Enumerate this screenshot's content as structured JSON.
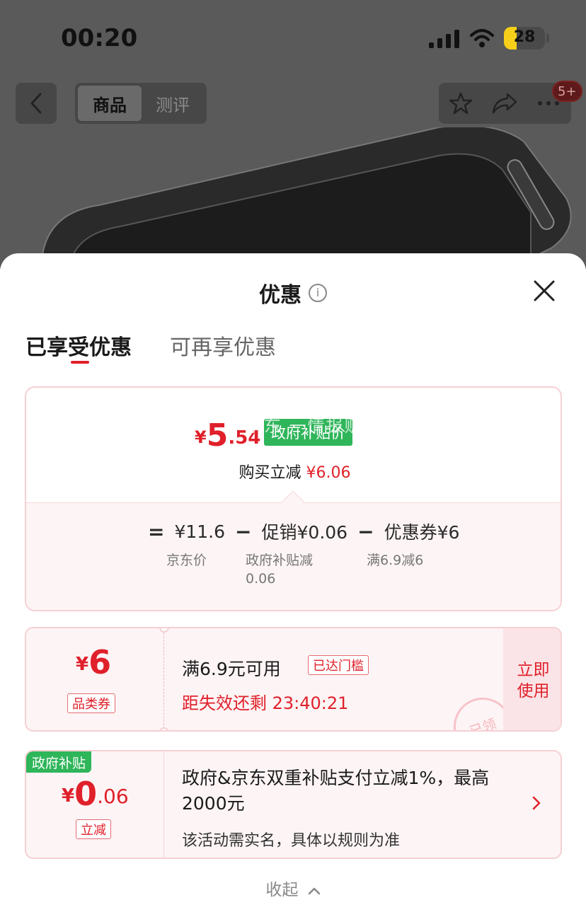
{
  "status_bar": {
    "time": "00:20",
    "battery": "28"
  },
  "nav": {
    "segments": [
      "商品",
      "测评"
    ],
    "badge": "5+",
    "icons": [
      "back-icon",
      "star-icon",
      "share-icon",
      "more-icon"
    ]
  },
  "sheet": {
    "title": "优惠",
    "info_glyph": "i",
    "tabs": [
      "已享受优惠",
      "可再享优惠"
    ],
    "summary": {
      "price_yen": "¥",
      "price_int": "5",
      "price_dec": ".54",
      "tag": "政府补贴价",
      "watermark": "京东 一情报贩",
      "reduce_label": "购买立减 ",
      "reduce_value": "¥6.06",
      "calc": {
        "eq": "=",
        "base_value": "¥11.6",
        "base_label": "京东价",
        "minus1": "−",
        "promo_value": "促销¥0.06",
        "promo_label_1": "政府补贴减",
        "promo_label_2": "0.06",
        "minus2": "−",
        "coupon_value": "优惠券¥6",
        "coupon_label": "满6.9减6"
      }
    },
    "coupon": {
      "yen": "¥",
      "amount": "6",
      "type": "品类券",
      "title": "满6.9元可用",
      "state": "已达门槛",
      "countdown": "距失效还剩 23:40:21",
      "use_line1": "立即",
      "use_line2": "使用",
      "stamp": "已领"
    },
    "subsidy": {
      "tag": "政府补贴",
      "yen": "¥",
      "int": "0",
      "dec": ".06",
      "type": "立减",
      "title": "政府&京东双重补贴支付立减1%，最高2000元",
      "note": "该活动需实名，具体以规则为准"
    },
    "collapse": "收起"
  },
  "colors": {
    "accent": "#e0202a",
    "green": "#2fb55a"
  }
}
